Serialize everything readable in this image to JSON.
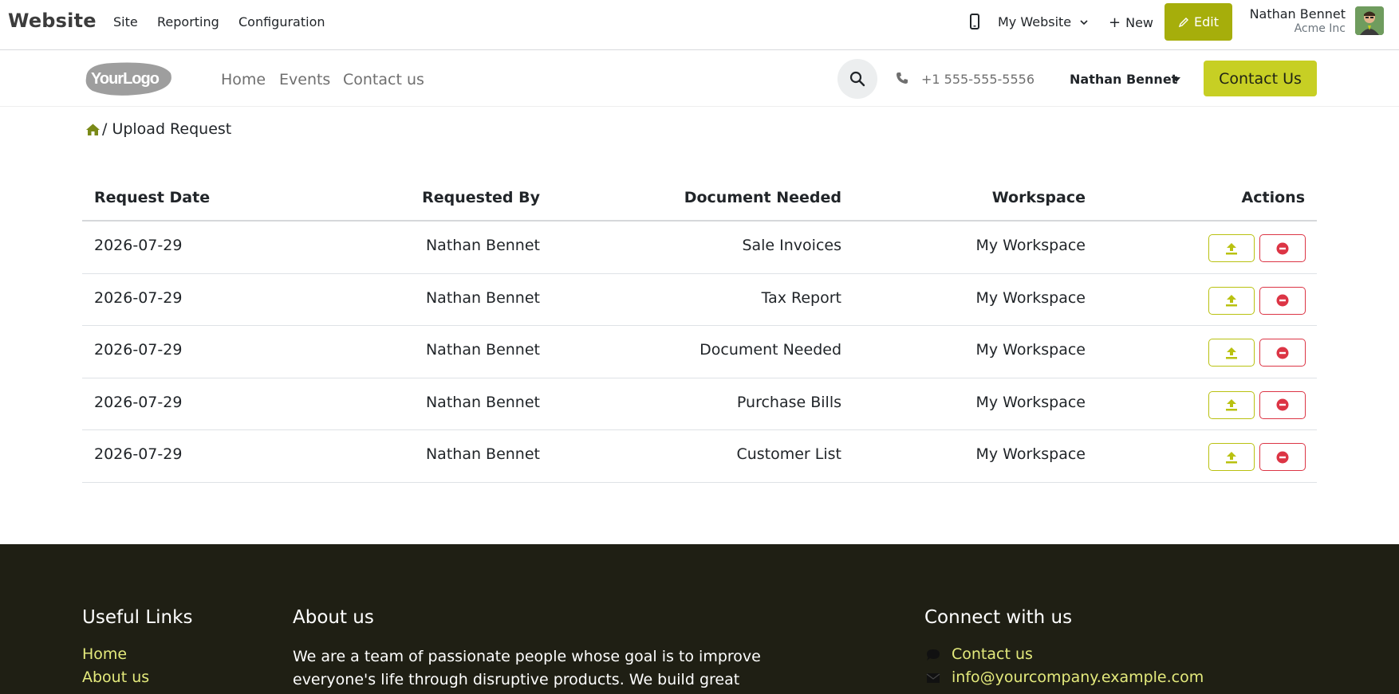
{
  "adminbar": {
    "brand": "Website",
    "menu": [
      "Site",
      "Reporting",
      "Configuration"
    ],
    "website_selector": "My Website",
    "new_label": "New",
    "edit_label": "Edit",
    "user_name": "Nathan Bennet",
    "user_company": "Acme Inc"
  },
  "header": {
    "logo_text": "YourLogo",
    "nav": [
      "Home",
      "Events",
      "Contact us"
    ],
    "phone": "+1 555-555-5556",
    "user": "Nathan Bennet",
    "contact_button": "Contact Us"
  },
  "breadcrumb": {
    "current": "/ Upload Request"
  },
  "table": {
    "headers": [
      "Request Date",
      "Requested By",
      "Document Needed",
      "Workspace",
      "Actions"
    ],
    "rows": [
      {
        "date": "2026-07-29",
        "by": "Nathan Bennet",
        "doc": "Sale Invoices",
        "workspace": "My Workspace"
      },
      {
        "date": "2026-07-29",
        "by": "Nathan Bennet",
        "doc": "Tax Report",
        "workspace": "My Workspace"
      },
      {
        "date": "2026-07-29",
        "by": "Nathan Bennet",
        "doc": "Document Needed",
        "workspace": "My Workspace"
      },
      {
        "date": "2026-07-29",
        "by": "Nathan Bennet",
        "doc": "Purchase Bills",
        "workspace": "My Workspace"
      },
      {
        "date": "2026-07-29",
        "by": "Nathan Bennet",
        "doc": "Customer List",
        "workspace": "My Workspace"
      }
    ]
  },
  "footer": {
    "useful_links_title": "Useful Links",
    "useful_links": [
      "Home",
      "About us"
    ],
    "about_title": "About us",
    "about_text": "We are a team of passionate people whose goal is to improve everyone's life through disruptive products. We build great products",
    "connect_title": "Connect with us",
    "connect_links": [
      "Contact us",
      "info@yourcompany.example.com"
    ]
  },
  "colors": {
    "primary": "#c7cf24",
    "edit": "#a6ae0b",
    "danger": "#dc3545",
    "footer_bg": "#1f1f14",
    "footer_link": "#e4ea7c"
  },
  "icons": {
    "device": "mobile-icon",
    "search": "search-icon",
    "phone": "phone-icon",
    "home": "home-icon",
    "upload": "upload-icon",
    "remove": "minus-circle-icon",
    "chat": "comment-icon",
    "mail": "envelope-icon"
  }
}
